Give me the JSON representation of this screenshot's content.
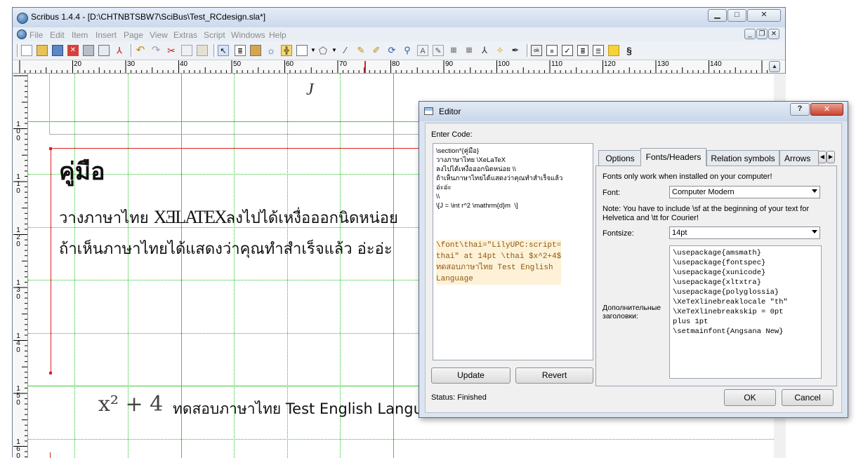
{
  "main": {
    "title": "Scribus 1.4.4 - [D:\\CHTNBTSBW7\\SciBus\\Test_RCdesign.sla*]",
    "menus": [
      "File",
      "Edit",
      "Item",
      "Insert",
      "Page",
      "View",
      "Extras",
      "Script",
      "Windows",
      "Help"
    ],
    "toolbar_icons": [
      "new-icon",
      "open-icon",
      "save-icon",
      "close-icon",
      "print-icon",
      "preflight-icon",
      "pdf-icon",
      "undo-icon",
      "redo-icon",
      "cut-icon",
      "copy-icon",
      "paste-icon",
      "select-icon",
      "text-frame-icon",
      "image-frame-icon",
      "render-frame-icon",
      "table-icon",
      "shape-icon",
      "polygon-icon",
      "line-icon",
      "bezier-icon",
      "freehand-icon",
      "rotate-icon",
      "zoom-icon",
      "edit-contents-icon",
      "edit-text-icon",
      "link-frames-icon",
      "unlink-frames-icon",
      "measure-icon",
      "copy-properties-icon",
      "eyedropper-icon",
      "pdf-push-button-icon",
      "pdf-text-field-icon",
      "pdf-checkbox-icon",
      "pdf-combobox-icon",
      "pdf-listbox-icon",
      "pdf-annotation-icon",
      "pdf-link-icon"
    ],
    "ruler_labels": [
      "20",
      "30",
      "40",
      "50",
      "60",
      "70",
      "80",
      "90",
      "100",
      "110",
      "120",
      "130",
      "140"
    ],
    "vruler_labels": [
      [
        "1",
        "0",
        "0"
      ],
      [
        "1",
        "1",
        "0"
      ],
      [
        "1",
        "2",
        "0"
      ],
      [
        "1",
        "3",
        "0"
      ],
      [
        "1",
        "4",
        "0"
      ],
      [
        "1",
        "5",
        "0"
      ],
      [
        "1",
        "6",
        "0"
      ]
    ],
    "canvas": {
      "heading": "คู่มือ",
      "line1_a": "วางภาษาไทย",
      "line1_b": "XƎLATEX",
      "line1_c": "ลงไปได้เหงื่อออกนิดหน่อย",
      "line2": "ถ้าเห็นภาษาไทยได้แสดงว่าคุณทำสำเร็จแล้ว อ่ะอ่ะ",
      "math": "x² + 4",
      "render_text": "ทดสอบภาษาไทย Test English Langu"
    }
  },
  "editor": {
    "title": "Editor",
    "help_glyph": "?",
    "close_glyph": "✕",
    "enter_code_label": "Enter Code:",
    "code_lines": [
      "\\section*{คู่มือ}",
      "วางภาษาไทย \\XeLaTeX",
      "ลงไปได้เหงื่อออกนิดหน่อย \\\\",
      "ถ้าเห็นภาษาไทยได้แสดงว่าคุณทำสำเร็จแล้ว",
      "อ่ะอ่ะ",
      "\\\\",
      "",
      "\\[J = \\int r^2 \\mathrm{d}m  \\]"
    ],
    "code_highlight": [
      "\\font\\thai=\"LilyUPC:script=",
      "thai\" at 14pt \\thai $x^2+4$",
      "ทดสอบภาษาไทย Test English",
      "Language"
    ],
    "update_button": "Update",
    "revert_button": "Revert",
    "status": "Status: Finished",
    "tabs": [
      "Options",
      "Fonts/Headers",
      "Relation symbols",
      "Arrows"
    ],
    "active_tab": "Fonts/Headers",
    "fonts_note": "Fonts only work when installed on your computer!",
    "font_label": "Font:",
    "font_value": "Computer Modern",
    "note_line1": "Note: You have to include \\sf at the beginning of your text for",
    "note_line2": "Helvetica and \\tt for Courier!",
    "fontsize_label": "Fontsize:",
    "fontsize_value": "14pt",
    "headers_label_1": "Дополнительные",
    "headers_label_2": "заголовки:",
    "headers_lines": [
      "\\usepackage{amsmath}",
      "\\usepackage{fontspec}",
      "\\usepackage{xunicode}",
      "\\usepackage{xltxtra}",
      "\\usepackage{polyglossia}",
      "\\XeTeXlinebreaklocale \"th\"",
      "\\XeTeXlinebreakskip = 0pt",
      "plus 1pt",
      "\\setmainfont{Angsana New}"
    ],
    "ok_button": "OK",
    "cancel_button": "Cancel"
  }
}
